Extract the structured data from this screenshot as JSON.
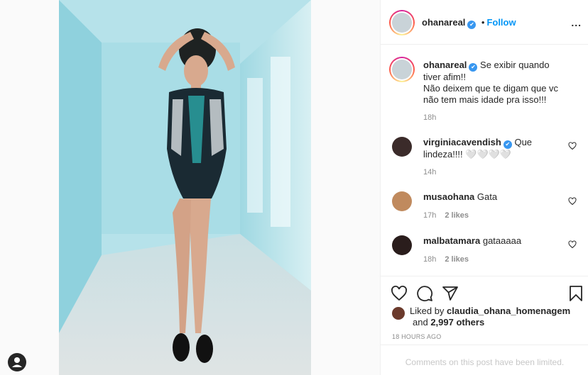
{
  "post": {
    "author": "ohanareal",
    "follow_label": "Follow",
    "separator": "•",
    "more_label": "...",
    "verified_glyph": "✔"
  },
  "caption": {
    "username": "ohanareal",
    "line1": "Se exibir quando tiver afim!!",
    "line2": "Não deixem que te digam que vc não tem mais idade pra isso!!!",
    "time": "18h"
  },
  "comments": [
    {
      "username": "virginiacavendish",
      "verified": true,
      "text": "Que lindeza!!!! 🤍🤍🤍🤍",
      "time": "14h",
      "likes": ""
    },
    {
      "username": "musaohana",
      "verified": false,
      "text": "Gata",
      "time": "17h",
      "likes": "2 likes"
    },
    {
      "username": "malbatamara",
      "verified": false,
      "text": "gataaaaa",
      "time": "18h",
      "likes": "2 likes"
    }
  ],
  "likes": {
    "prefix": "Liked by",
    "user": "claudia_ohana_homenagem",
    "and": "and",
    "others": "2,997 others"
  },
  "timestamp": "18 HOURS AGO",
  "comments_limited": "Comments on this post have been limited.",
  "icons": {
    "like": "heart-icon",
    "comment": "comment-icon",
    "share": "share-icon",
    "save": "bookmark-icon",
    "options": "more-icon"
  },
  "colors": {
    "accent": "#0095f6",
    "verified": "#3897f0",
    "muted": "#8e8e8e"
  }
}
